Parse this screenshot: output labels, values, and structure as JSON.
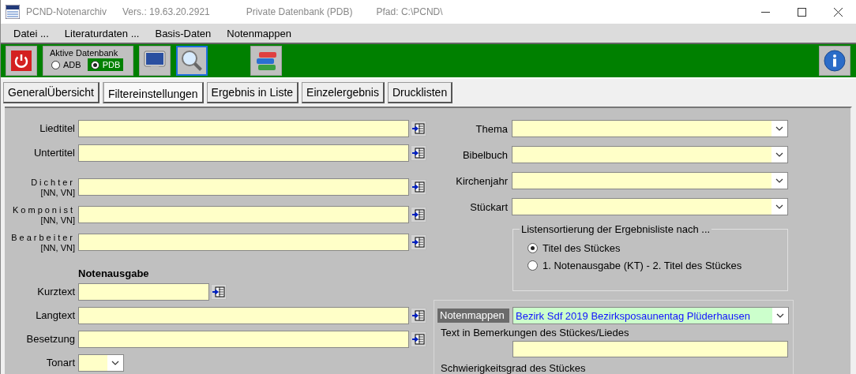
{
  "window": {
    "title": "PCND-Notenarchiv",
    "version": "Vers.: 19.63.20.2921",
    "database": "Private Datenbank (PDB)",
    "path": "Pfad: C:\\PCND\\"
  },
  "menu": [
    "Datei ...",
    "Literaturdaten ...",
    "Basis-Daten",
    "Notenmappen"
  ],
  "toolbar": {
    "buttons": [
      {
        "kind": "power",
        "selected": false
      },
      {
        "kind": "database"
      },
      {
        "kind": "monitor",
        "selected": false
      },
      {
        "kind": "search",
        "selected": true
      },
      {
        "kind": "books",
        "selected": false
      },
      {
        "kind": "info",
        "selected": false
      }
    ],
    "active_db": {
      "label": "Aktive Datenbank",
      "options": [
        {
          "label": "ADB",
          "selected": false
        },
        {
          "label": "PDB",
          "selected": true
        }
      ]
    }
  },
  "tabs": [
    {
      "label": "GeneralÜbersicht",
      "selected": false
    },
    {
      "label": "Filtereinstellungen",
      "selected": true
    },
    {
      "label": "Ergebnis in Liste",
      "selected": false
    },
    {
      "label": "Einzelergebnis",
      "selected": false
    },
    {
      "label": "Drucklisten",
      "selected": false
    }
  ],
  "filter": {
    "titles": [
      {
        "label": "Liedtitel",
        "kind": "text"
      },
      {
        "label": "Untertitel",
        "kind": "text"
      }
    ],
    "persons": [
      {
        "label": "Dichter",
        "sublabel": "[NN, VN]",
        "kind": "text"
      },
      {
        "label": "Komponist",
        "sublabel": "[NN, VN]",
        "kind": "text"
      },
      {
        "label": "Bearbeiter",
        "sublabel": "[NN, VN]",
        "kind": "text"
      }
    ],
    "edition": {
      "heading": "Notenausgabe",
      "fields": [
        {
          "label": "Kurztext",
          "kind": "short"
        },
        {
          "label": "Langtext",
          "kind": "text"
        },
        {
          "label": "Besetzung",
          "kind": "text"
        },
        {
          "label": "Tonart",
          "kind": "combo"
        }
      ]
    },
    "combos": [
      {
        "label": "Thema"
      },
      {
        "label": "Bibelbuch"
      },
      {
        "label": "Kirchenjahr"
      },
      {
        "label": "Stückart"
      }
    ],
    "sort": {
      "title": "Listensortierung der Ergebnisliste  nach ...",
      "options": [
        {
          "label": "Titel des Stückes",
          "selected": true
        },
        {
          "label": "1. Notenausgabe (KT) - 2. Titel des Stückes",
          "selected": false
        }
      ]
    },
    "folders": {
      "label": "Notenmappen",
      "value": "Bezirk Sdf 2019 Bezirksposaunentag Plüderhausen",
      "remarks_label": "Text in Bemerkungen des Stückes/Liedes",
      "difficulty_label": "Schwierigkeitsgrad des Stückes"
    }
  }
}
